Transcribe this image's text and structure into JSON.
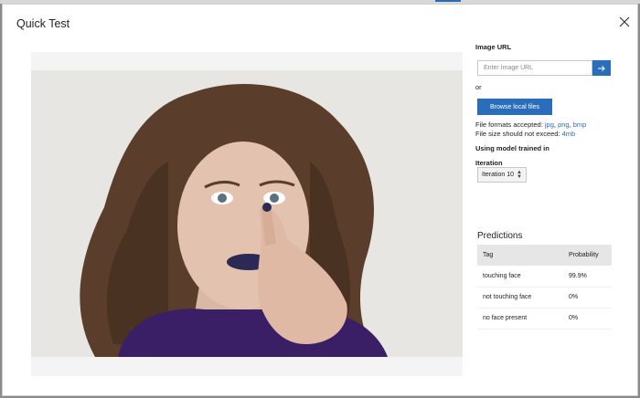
{
  "dialog": {
    "title": "Quick Test"
  },
  "image_url": {
    "label": "Image URL",
    "placeholder": "Enter Image URL"
  },
  "or_text": "or",
  "browse": {
    "label": "Browse local files"
  },
  "formats": {
    "prefix": "File formats accepted: ",
    "jpg": "jpg",
    "png": "png",
    "bmp": "bmp",
    "sep": ", ",
    "size_prefix": "File size should not exceed: ",
    "size_value": "4mb"
  },
  "model": {
    "using_label": "Using model trained in",
    "iteration_label": "Iteration",
    "iteration_value": "Iteration 10"
  },
  "predictions": {
    "title": "Predictions",
    "col_tag": "Tag",
    "col_prob": "Probability",
    "rows": [
      {
        "tag": "touching face",
        "prob": "99.9%"
      },
      {
        "tag": "not touching face",
        "prob": "0%"
      },
      {
        "tag": "no face present",
        "prob": "0%"
      }
    ]
  },
  "colors": {
    "accent": "#2a6ebb",
    "header_bg": "#e6e6e6",
    "overlay": "#8a8a8a"
  },
  "icons": {
    "close": "close-icon",
    "go": "arrow-right-icon",
    "select": "updown-arrows-icon"
  }
}
